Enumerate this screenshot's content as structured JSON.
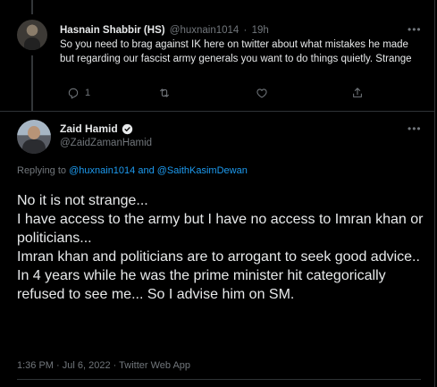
{
  "reply": {
    "author_name": "Hasnain Shabbir (HS)",
    "handle": "@huxnain1014",
    "separator": "·",
    "time": "19h",
    "text": "So you need to brag against IK here on twitter about what mistakes he made but regarding our fascist army generals you want to do things quietly. Strange",
    "reply_count": "1",
    "retweet_count": "",
    "like_count": ""
  },
  "main": {
    "author_name": "Zaid Hamid",
    "handle": "@ZaidZamanHamid",
    "verified": true,
    "replying_prefix": "Replying to",
    "replying_user1": "@huxnain1014",
    "replying_and": "and",
    "replying_user2": "@SaithKasimDewan",
    "text": "No it is not strange...\nI have access to the army but I have no access to Imran khan or politicians...\nImran khan and politicians are to arrogant to seek good advice..\nIn 4 years while he was the prime minister hit categorically refused to see me... So I advise him on SM.",
    "timestamp": "1:36 PM · Jul 6, 2022 · Twitter Web App"
  },
  "icons": {
    "more": "more-icon",
    "reply": "reply-icon",
    "retweet": "retweet-icon",
    "like": "like-icon",
    "share": "share-icon",
    "verified": "verified-badge-icon"
  },
  "colors": {
    "background": "#000000",
    "text": "#e7e9ea",
    "secondary": "#71767b",
    "link": "#1d9bf0",
    "border": "#2f3336"
  }
}
